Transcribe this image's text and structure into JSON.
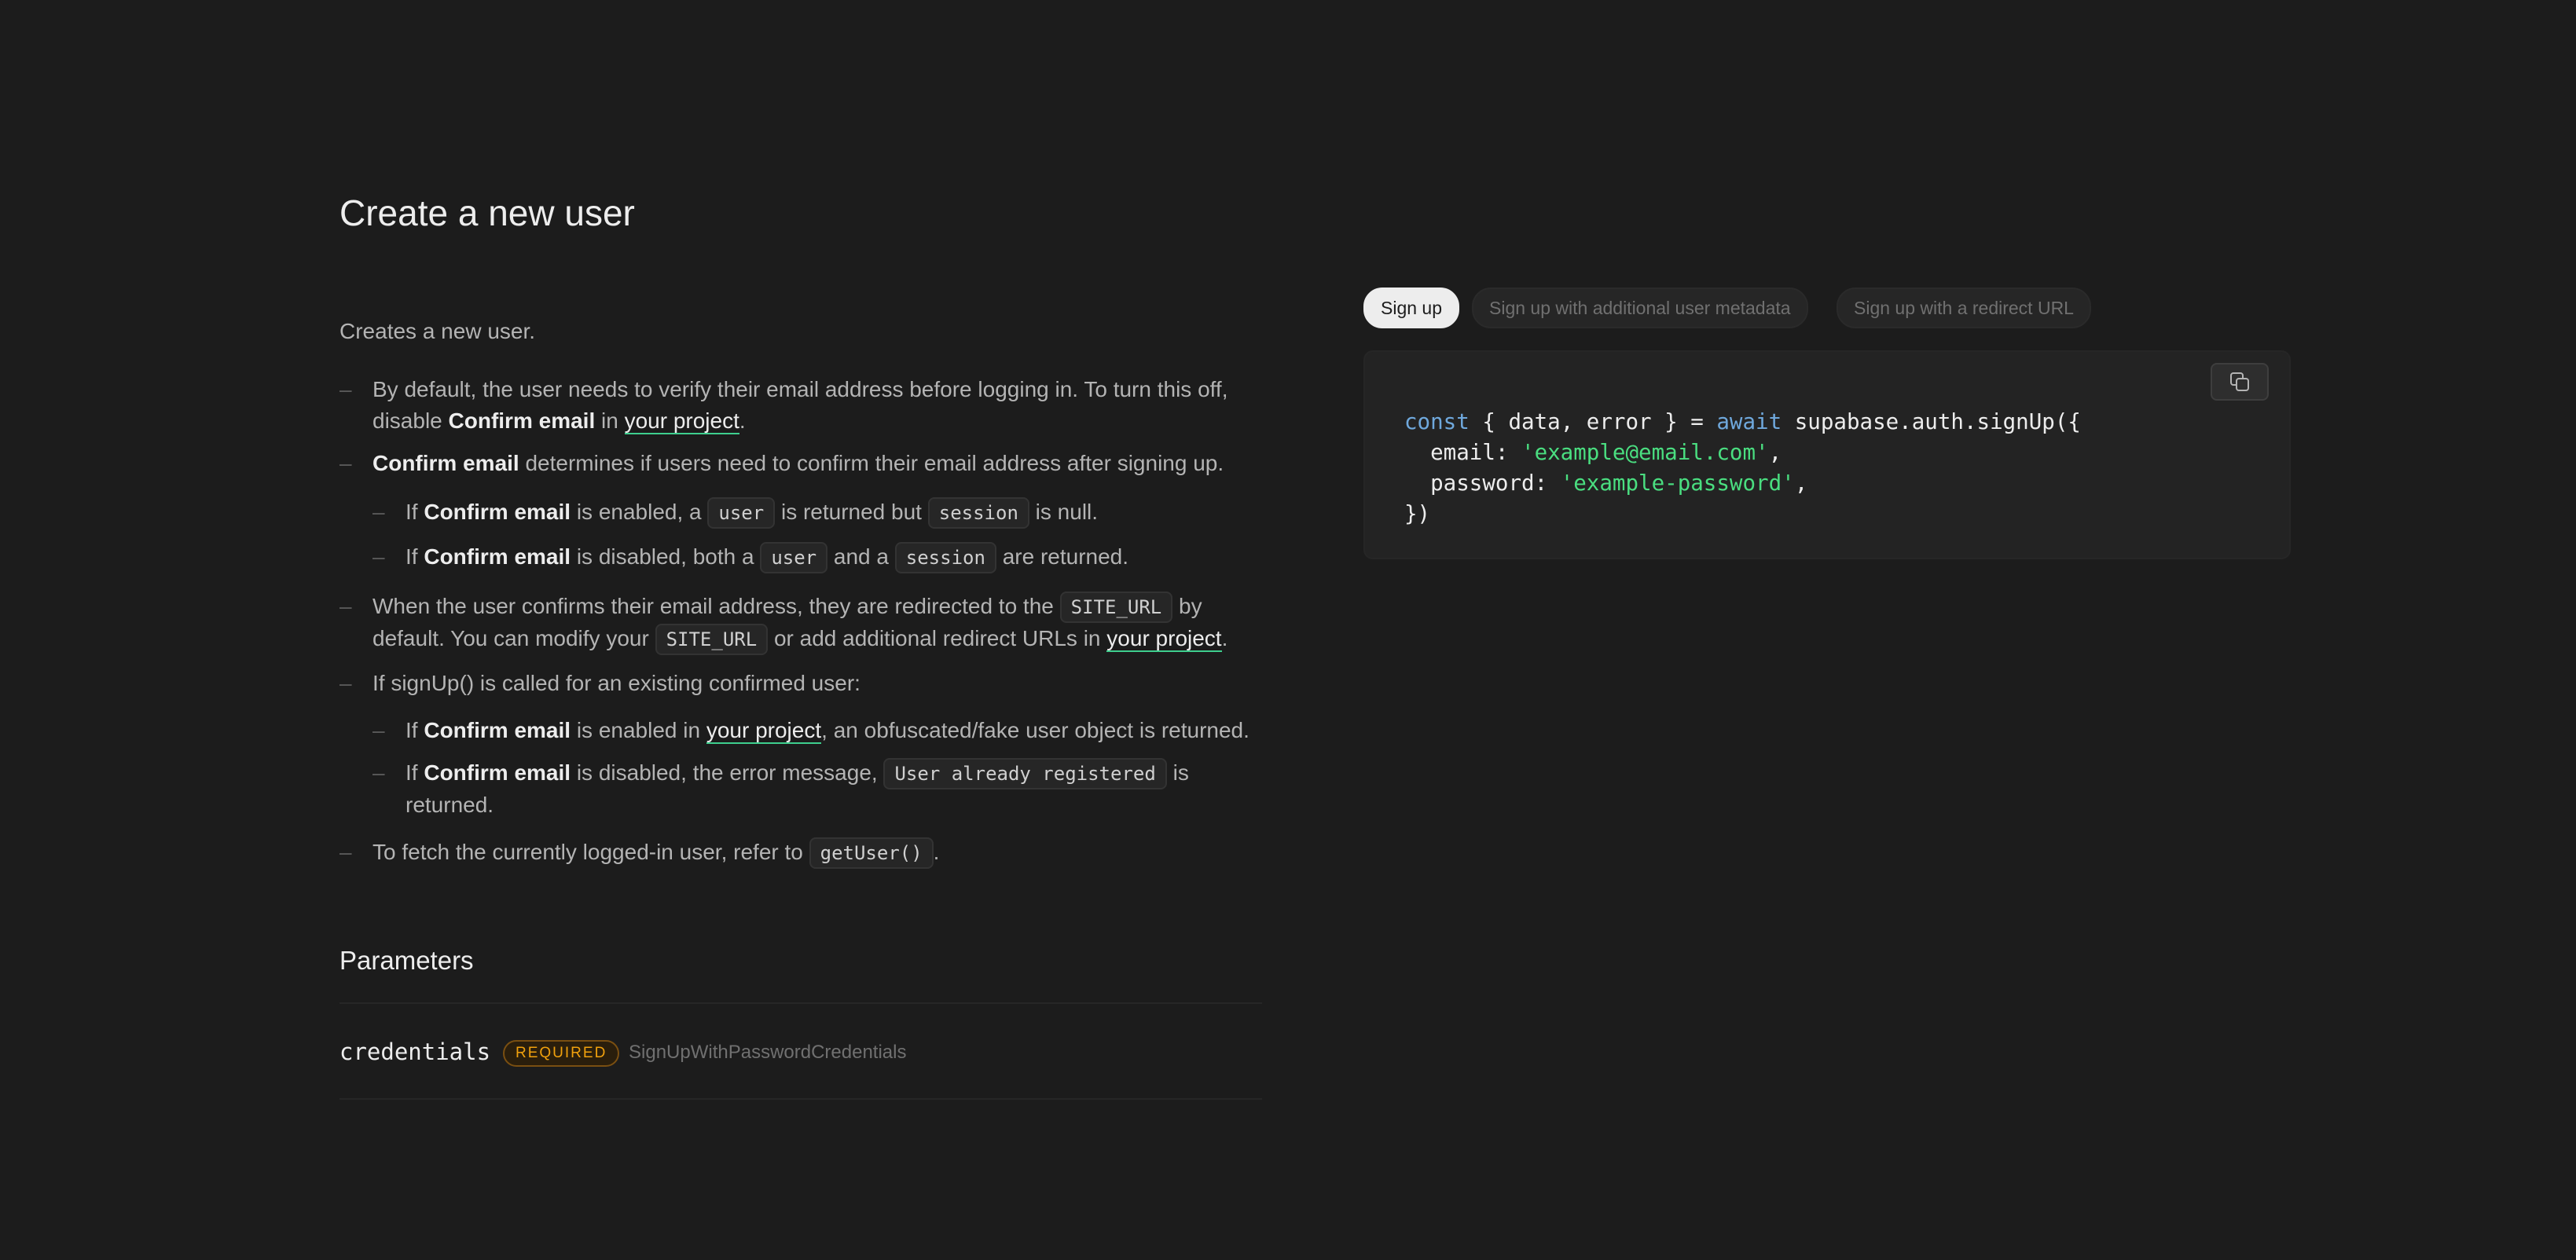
{
  "page": {
    "title": "Create a new user",
    "intro": "Creates a new user."
  },
  "bullets": {
    "b1": {
      "pre": "By default, the user needs to verify their email address before logging in. To turn this off, disable ",
      "bold": "Confirm email",
      "mid": " in ",
      "link": "your project",
      "post": "."
    },
    "b2": {
      "bold": "Confirm email",
      "post": " determines if users need to confirm their email address after signing up."
    },
    "b2a": {
      "pre": "If ",
      "bold": "Confirm email",
      "mid1": " is enabled, a ",
      "code1": "user",
      "mid2": " is returned but ",
      "code2": "session",
      "post": " is null."
    },
    "b2b": {
      "pre": "If ",
      "bold": "Confirm email",
      "mid1": " is disabled, both a ",
      "code1": "user",
      "mid2": " and a ",
      "code2": "session",
      "post": " are returned."
    },
    "b3": {
      "pre": "When the user confirms their email address, they are redirected to the ",
      "code1": "SITE_URL",
      "mid1": " by default. You can modify your ",
      "code2": "SITE_URL",
      "mid2": " or add additional redirect URLs in ",
      "link": "your project",
      "post": "."
    },
    "b4": {
      "text": "If signUp() is called for an existing confirmed user:"
    },
    "b4a": {
      "pre": "If ",
      "bold": "Confirm email",
      "mid": " is enabled in ",
      "link": "your project",
      "post": ", an obfuscated/fake user object is returned."
    },
    "b4b": {
      "pre": "If ",
      "bold": "Confirm email",
      "mid": " is disabled, the error message, ",
      "code": "User already registered",
      "post": " is returned."
    },
    "b5": {
      "pre": "To fetch the currently logged-in user, refer to ",
      "code": "getUser()",
      "post": "."
    }
  },
  "parameters": {
    "title": "Parameters",
    "items": [
      {
        "name": "credentials",
        "badge": "REQUIRED",
        "type": "SignUpWithPasswordCredentials"
      }
    ]
  },
  "tabs": [
    {
      "label": "Sign up",
      "active": true
    },
    {
      "label": "Sign up with additional user metadata",
      "active": false
    },
    {
      "label": "Sign up with a redirect URL",
      "active": false
    }
  ],
  "code": {
    "line1": {
      "kw1": "const",
      "a": " { data, error } = ",
      "kw2": "await",
      "b": " supabase.auth.signUp({"
    },
    "line2": {
      "a": "  email: ",
      "str": "'example@email.com'",
      "b": ","
    },
    "line3": {
      "a": "  password: ",
      "str": "'example-password'",
      "b": ","
    },
    "line4": {
      "a": "})"
    },
    "copy_icon": "copy-icon"
  },
  "colors": {
    "background": "#1c1c1c",
    "brand": "#3ecf8e",
    "keyword": "#6fa8dc",
    "string": "#4ade80",
    "badge": "#f1a10d"
  }
}
